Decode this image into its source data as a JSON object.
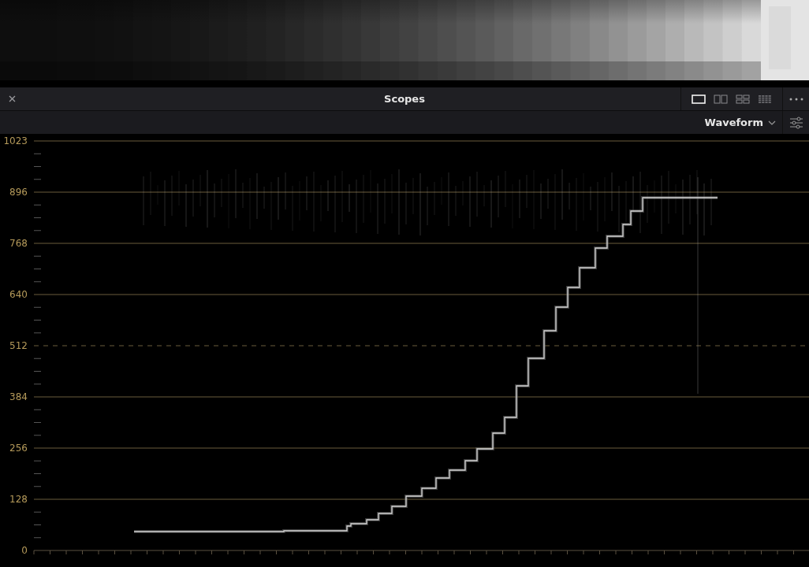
{
  "panel": {
    "title": "Scopes",
    "layouts": [
      {
        "kind": "single",
        "selected": true
      },
      {
        "kind": "dual",
        "selected": false
      },
      {
        "kind": "quad",
        "selected": false
      },
      {
        "kind": "grid",
        "selected": false
      }
    ],
    "mode": "Waveform"
  },
  "scope": {
    "y_labels": [
      {
        "label": "1023",
        "kind": "solid"
      },
      {
        "label": "896",
        "kind": "solid"
      },
      {
        "label": "768",
        "kind": "solid"
      },
      {
        "label": "640",
        "kind": "solid"
      },
      {
        "label": "512",
        "kind": "dashed"
      },
      {
        "label": "384",
        "kind": "solid"
      },
      {
        "label": "256",
        "kind": "solid"
      },
      {
        "label": "128",
        "kind": "solid"
      },
      {
        "label": "0",
        "kind": "axis"
      }
    ]
  }
}
